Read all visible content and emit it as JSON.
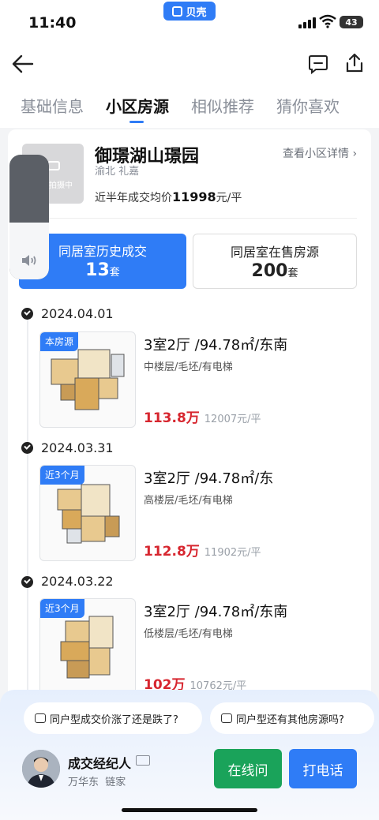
{
  "status_bar": {
    "time": "11:40",
    "app_name": "贝壳",
    "battery": "43"
  },
  "tabs": [
    {
      "label": "基础信息"
    },
    {
      "label": "小区房源"
    },
    {
      "label": "相似推荐"
    },
    {
      "label": "猜你喜欢"
    }
  ],
  "community": {
    "name": "御璟湖山璟园",
    "district": "渝北 礼嘉",
    "detail_link": "查看小区详情 ›",
    "thumb_text": "正在拍摄中",
    "avg_label": "近半年成交均价",
    "avg_price": "11998",
    "avg_unit": "元/平"
  },
  "toggle": {
    "history_label": "同居室历史成交",
    "history_count": "13",
    "onsale_label": "同居室在售房源",
    "onsale_count": "200",
    "count_unit": "套"
  },
  "listings": [
    {
      "date": "2024.04.01",
      "badge": "本房源",
      "title": "3室2厅 /94.78㎡/东南",
      "sub": "中楼层/毛坯/有电梯",
      "price": "113.8万",
      "unit_price": "12007元/平"
    },
    {
      "date": "2024.03.31",
      "badge": "近3个月",
      "title": "3室2厅 /94.78㎡/东",
      "sub": "高楼层/毛坯/有电梯",
      "price": "112.8万",
      "unit_price": "11902元/平"
    },
    {
      "date": "2024.03.22",
      "badge": "近3个月",
      "title": "3室2厅 /94.78㎡/东南",
      "sub": "低楼层/毛坯/有电梯",
      "price": "102万",
      "unit_price": "10762元/平"
    }
  ],
  "questions": [
    "同户型成交价涨了还是跌了?",
    "同户型还有其他房源吗?"
  ],
  "agent": {
    "role": "成交经纪人",
    "name": "万华东",
    "company": "链家"
  },
  "actions": {
    "online": "在线问",
    "call": "打电话"
  },
  "colors": {
    "accent": "#2f7cf6",
    "price": "#d7262f",
    "online": "#1aa35a"
  }
}
